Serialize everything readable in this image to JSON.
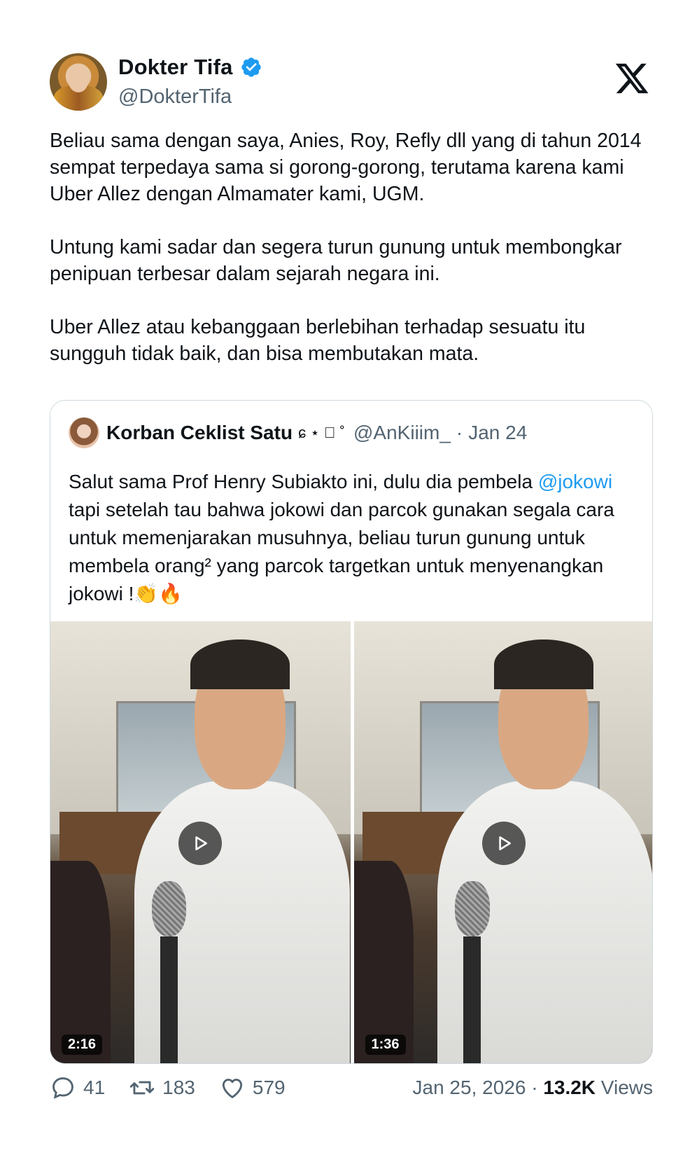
{
  "author": {
    "display_name": "Dokter Tifa",
    "handle": "@DokterTifa",
    "verified_icon": "verified-badge-icon",
    "avatar_icon": "avatar"
  },
  "platform_logo": "x-logo-icon",
  "tweet": {
    "text": "Beliau sama dengan saya, Anies, Roy, Refly dll yang di tahun 2014 sempat terpedaya sama si gorong-gorong, terutama karena kami Uber Allez dengan Almamater kami, UGM.\n\nUntung kami sadar dan segera turun gunung untuk membongkar penipuan terbesar dalam sejarah negara ini.\n\nUber Allez atau kebanggaan berlebihan terhadap sesuatu itu sungguh tidak baik, dan bisa membutakan mata."
  },
  "quoted": {
    "display_name": "Korban Ceklist Satu",
    "decoration": "ɕ ⋆ ⃞ ˚",
    "handle": "@AnKiiim_",
    "separator": "·",
    "date": "Jan 24",
    "text_before": "Salut sama Prof Henry Subiakto ini, dulu dia pembela ",
    "mention": "@jokowi",
    "text_after": " tapi setelah tau bahwa jokowi dan parcok gunakan segala cara untuk memenjarakan musuhnya, beliau turun gunung untuk membela orang² yang parcok targetkan untuk menyenangkan jokowi !👏🔥",
    "videos": [
      {
        "duration": "2:16"
      },
      {
        "duration": "1:36"
      }
    ]
  },
  "stats": {
    "replies": "41",
    "reposts": "183",
    "likes": "579",
    "date": "Jan 25, 2026",
    "separator": "·",
    "views_count": "13.2K",
    "views_label": " Views"
  },
  "colors": {
    "accent": "#1d9bf0",
    "secondary_text": "#536471",
    "border": "#cfd9de"
  }
}
